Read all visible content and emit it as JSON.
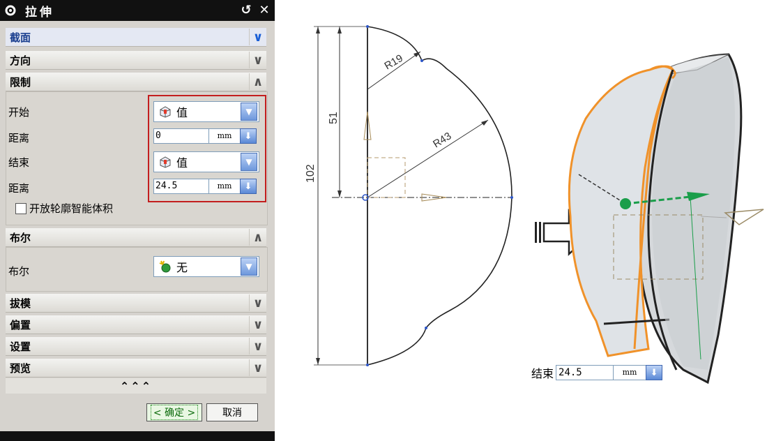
{
  "dialog": {
    "title": "拉伸",
    "buttons": {
      "reset": "↺",
      "close": "✕"
    },
    "sections": {
      "section": "截面",
      "direction": "方向",
      "limits": "限制",
      "boolean": "布尔",
      "draft": "拔模",
      "offset": "偏置",
      "settings": "设置",
      "preview": "预览"
    },
    "limits": {
      "start_label": "开始",
      "start_value": "值",
      "start_distance_label": "距离",
      "start_distance": "0",
      "end_label": "结束",
      "end_value": "值",
      "end_distance_label": "距离",
      "end_distance": "24.5",
      "unit": "mm",
      "open_profile_label": "开放轮廓智能体积"
    },
    "boolean": {
      "label": "布尔",
      "value": "无"
    },
    "more": "⌃⌃⌃",
    "ok_label": "< 确定 >",
    "cancel_label": "取消"
  },
  "sketch": {
    "dim_total": "102",
    "dim_upper": "51",
    "radius_small": "R19",
    "radius_large": "R43"
  },
  "end_input": {
    "label": "结束",
    "value": "24.5",
    "unit": "mm"
  },
  "colors": {
    "highlight_box": "#c31e1e",
    "edge_orange": "#f0922a",
    "handle_green": "#1a9e4a"
  }
}
